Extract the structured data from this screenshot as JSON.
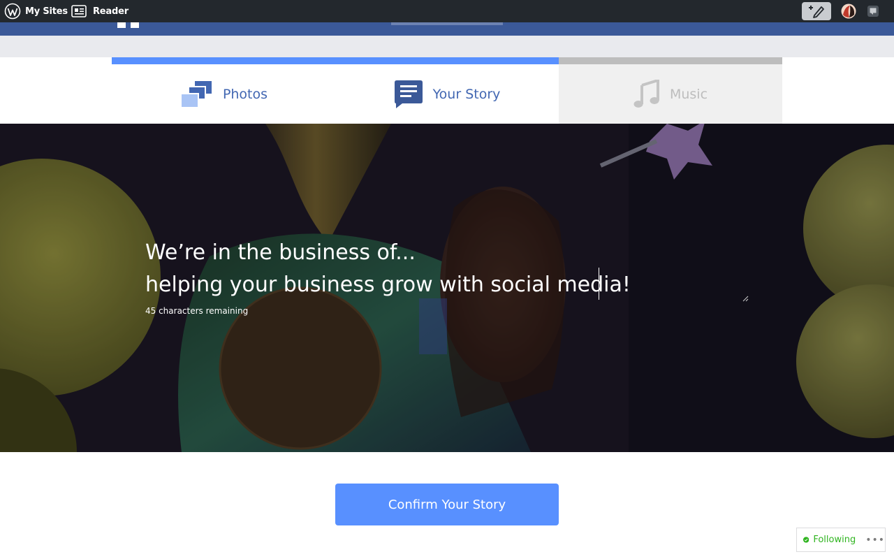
{
  "admin_bar": {
    "my_sites_label": "My Sites",
    "reader_label": "Reader",
    "icons": [
      "wordpress-logo-icon",
      "reader-icon",
      "write-post-icon",
      "user-avatar",
      "notifications-icon"
    ]
  },
  "steps": [
    {
      "label": "Photos",
      "icon": "photos-icon",
      "state": "complete"
    },
    {
      "label": "Your Story",
      "icon": "speech-bubble-icon",
      "state": "current"
    },
    {
      "label": "Music",
      "icon": "music-note-icon",
      "state": "upcoming"
    }
  ],
  "progress": {
    "completed_steps": 2,
    "total_steps": 3
  },
  "story": {
    "text": "We’re in the business of...\nhelping your business grow with social media!",
    "characters_remaining": "45 characters remaining"
  },
  "confirm_button_label": "Confirm Your Story",
  "follow_widget": {
    "label": "Following",
    "more": "•••"
  },
  "colors": {
    "admin_bar": "#23282d",
    "header_blue": "#3b5998",
    "accent_blue": "#5890ff",
    "step_text": "#4267b2",
    "inactive_step_text": "#bdbdbd",
    "following_green": "#2fb41f"
  }
}
